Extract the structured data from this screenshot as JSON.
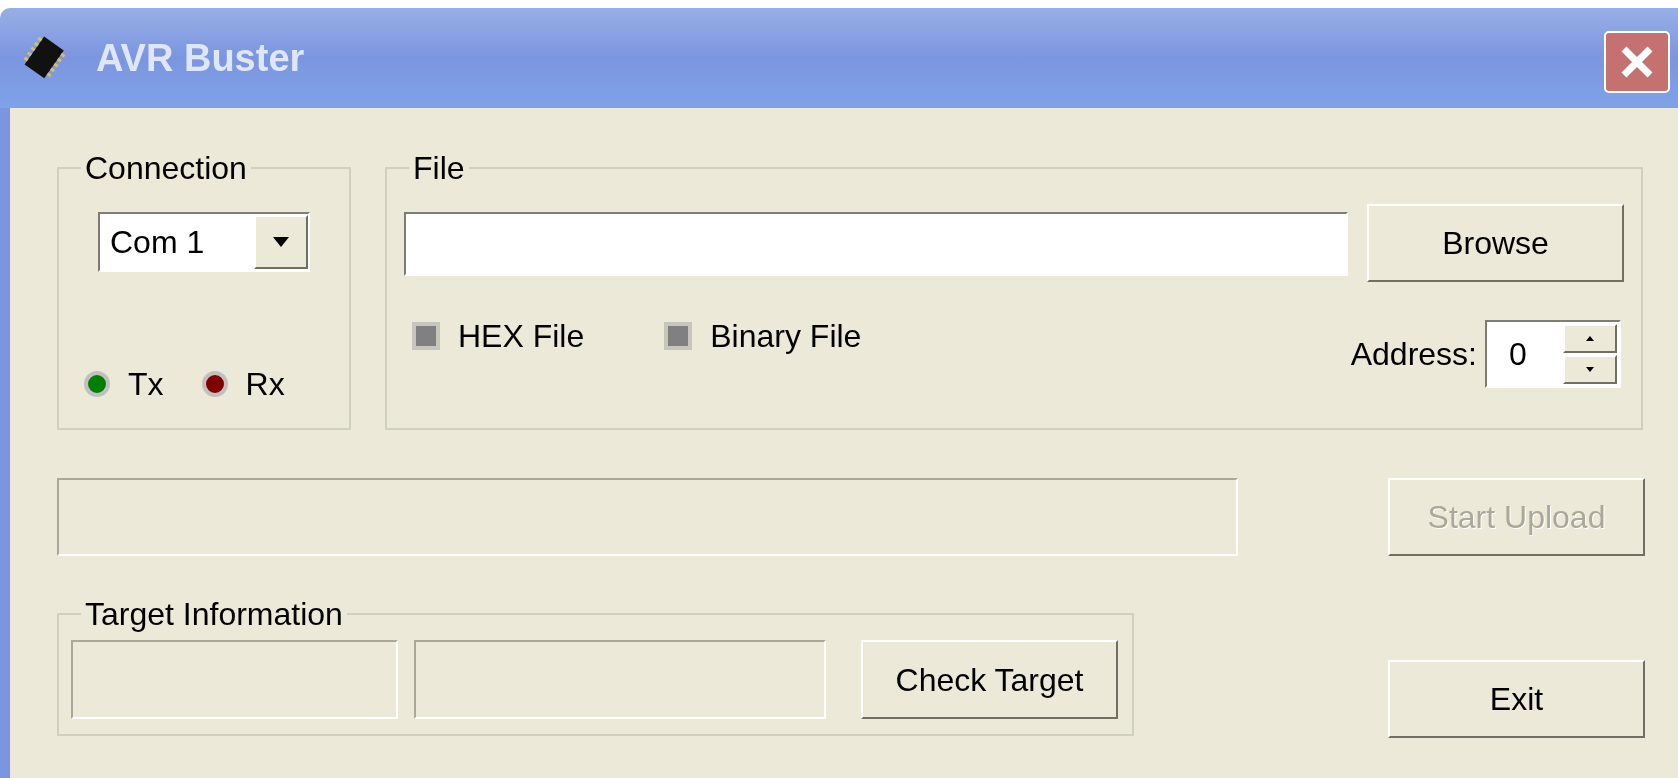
{
  "window": {
    "title": "AVR Buster"
  },
  "connection": {
    "legend": "Connection",
    "port": "Com 1",
    "leds": [
      {
        "label": "Tx",
        "color": "#008000"
      },
      {
        "label": "Rx",
        "color": "#800000"
      }
    ]
  },
  "file": {
    "legend": "File",
    "browse": "Browse",
    "options": [
      {
        "label": "HEX File",
        "grayed": true
      },
      {
        "label": "Binary File",
        "grayed": true
      }
    ],
    "address": {
      "label": "Address:",
      "value": "0"
    }
  },
  "progress": {
    "level": 0
  },
  "start_upload": {
    "label": "Start Upload",
    "disabled": true
  },
  "target": {
    "legend": "Target Information",
    "check": {
      "label": "Check Target",
      "disabled": false
    }
  },
  "exit": {
    "label": "Exit",
    "disabled": false
  }
}
